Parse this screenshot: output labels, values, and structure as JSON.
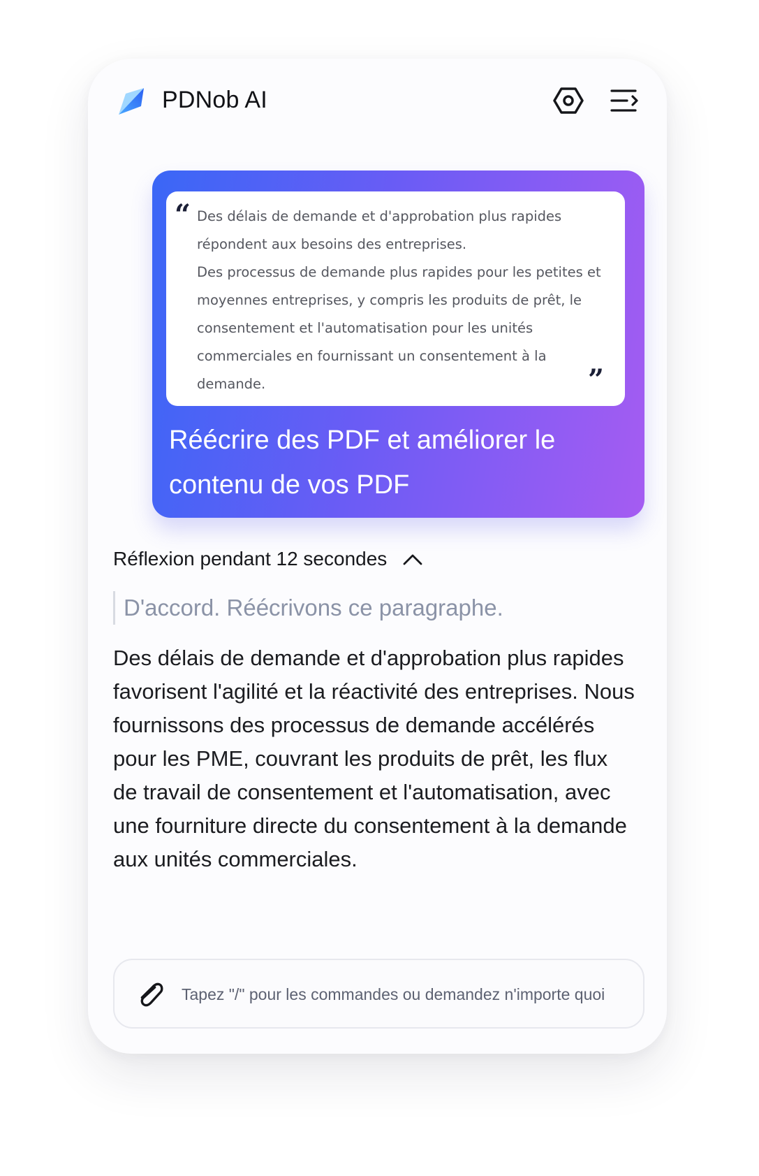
{
  "app": {
    "title": "PDNob AI"
  },
  "header": {
    "settings_icon": "hexagon-settings-icon",
    "menu_icon": "menu-collapse-icon"
  },
  "promo": {
    "quote_lines": [
      "Des délais de demande et d'approbation plus rapides répondent aux besoins des entreprises.",
      "Des processus de demande plus rapides pour les petites et moyennes entreprises, y compris les produits de prêt, le consentement et l'automatisation pour les unités commerciales en fournissant un consentement à la demande."
    ],
    "title": "Réécrire des PDF et améliorer le contenu de vos PDF",
    "gradient_colors": [
      "#3a67f6",
      "#a55cf2"
    ]
  },
  "reflection": {
    "label": "Réflexion pendant 12 secondes",
    "thought": "D'accord. Réécrivons ce paragraphe."
  },
  "answer": {
    "text": "Des délais de demande et d'approbation plus rapides favorisent l'agilité et la réactivité des entreprises. Nous fournissons des processus de demande accélérés pour les PME, couvrant les produits de prêt, les flux de travail de consentement et l'automatisation, avec une fourniture directe du consentement à la demande aux unités commerciales."
  },
  "input": {
    "placeholder": "Tapez \"/\" pour les commandes ou demandez n'importe quoi",
    "value": "",
    "attach_icon": "paperclip-icon"
  }
}
